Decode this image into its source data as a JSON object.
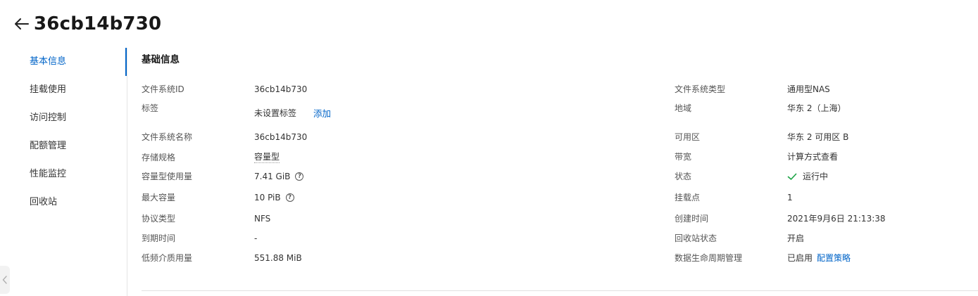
{
  "header": {
    "title": "36cb14b730"
  },
  "sidebar": {
    "items": [
      {
        "label": "基本信息"
      },
      {
        "label": "挂载使用"
      },
      {
        "label": "访问控制"
      },
      {
        "label": "配额管理"
      },
      {
        "label": "性能监控"
      },
      {
        "label": "回收站"
      }
    ]
  },
  "section": {
    "title": "基础信息"
  },
  "left": {
    "fs_id": {
      "label": "文件系统ID",
      "value": "36cb14b730"
    },
    "tags": {
      "label": "标签",
      "value": "未设置标签",
      "action": "添加"
    },
    "fs_name": {
      "label": "文件系统名称",
      "value": "36cb14b730"
    },
    "storage_spec": {
      "label": "存储规格",
      "value": "容量型"
    },
    "usage": {
      "label": "容量型使用量",
      "value": "7.41 GiB"
    },
    "max_capacity": {
      "label": "最大容量",
      "value": "10 PiB"
    },
    "protocol": {
      "label": "协议类型",
      "value": "NFS"
    },
    "expiry": {
      "label": "到期时间",
      "value": "-"
    },
    "ia_usage": {
      "label": "低频介质用量",
      "value": "551.88 MiB"
    }
  },
  "right": {
    "fs_type": {
      "label": "文件系统类型",
      "value": "通用型NAS"
    },
    "region": {
      "label": "地域",
      "value": "华东 2（上海）"
    },
    "zone": {
      "label": "可用区",
      "value": "华东 2 可用区 B"
    },
    "bandwidth": {
      "label": "带宽",
      "value": "计算方式查看"
    },
    "status": {
      "label": "状态",
      "value": "运行中"
    },
    "mount_points": {
      "label": "挂载点",
      "value": "1"
    },
    "created": {
      "label": "创建时间",
      "value": "2021年9月6日 21:13:38"
    },
    "recycle_status": {
      "label": "回收站状态",
      "value": "开启"
    },
    "lifecycle": {
      "label": "数据生命周期管理",
      "value": "已启用",
      "action": "配置策略"
    }
  },
  "colors": {
    "accent": "#0064c8",
    "success": "#1ba345"
  }
}
